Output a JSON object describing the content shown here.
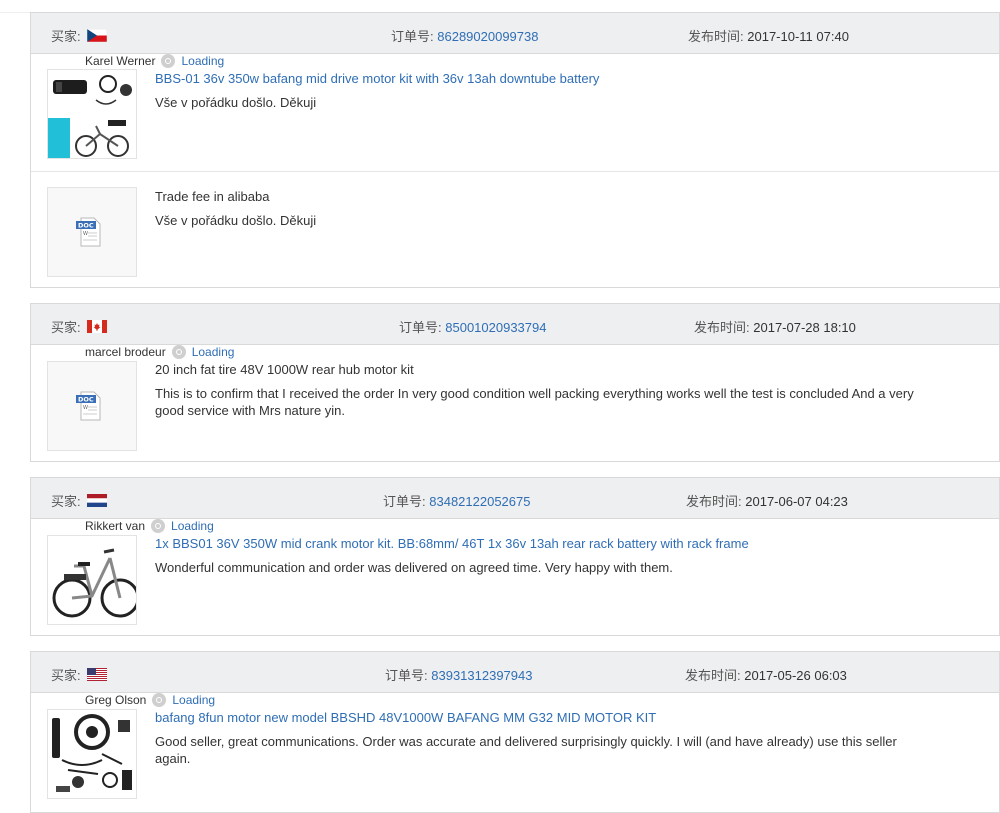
{
  "labels": {
    "buyer": "买家:",
    "order_no": "订单号:",
    "published": "发布时间:",
    "loading": "Loading"
  },
  "reviews": [
    {
      "country": "Czech Republic",
      "order_no": "86289020099738",
      "date": "2017-10-11 07:40",
      "reviewer": "Karel Werner",
      "items": [
        {
          "title": "BBS-01 36v 350w bafang mid drive motor kit with 36v 13ah downtube battery",
          "comment": "Vše v pořádku došlo. Děkuji"
        },
        {
          "title": "Trade fee in alibaba",
          "comment": "Vše v pořádku došlo. Děkuji",
          "icon": "DOC"
        }
      ]
    },
    {
      "country": "Canada",
      "order_no": "85001020933794",
      "date": "2017-07-28 18:10",
      "reviewer": "marcel brodeur",
      "items": [
        {
          "title": "20 inch fat tire 48V 1000W rear hub motor kit",
          "comment": "This is to confirm that I received the order In very good condition well packing everything works well the test is concluded And a very good service with Mrs nature yin.",
          "icon": "DOC"
        }
      ]
    },
    {
      "country": "Netherlands",
      "order_no": "83482122052675",
      "date": "2017-06-07 04:23",
      "reviewer": "Rikkert van",
      "items": [
        {
          "title": "1x BBS01 36V 350W mid crank motor kit. BB:68mm/ 46T 1x 36v 13ah rear rack battery with rack frame",
          "comment": "Wonderful communication and order was delivered on agreed time. Very happy with them."
        }
      ]
    },
    {
      "country": "United States",
      "order_no": "83931312397943",
      "date": "2017-05-26 06:03",
      "reviewer": "Greg Olson",
      "items": [
        {
          "title": "bafang 8fun motor new model BBSHD 48V1000W BAFANG MM G32 MID MOTOR KIT",
          "comment": "Good seller, great communications. Order was accurate and delivered surprisingly quickly. I will (and have already) use this seller again."
        }
      ]
    }
  ]
}
